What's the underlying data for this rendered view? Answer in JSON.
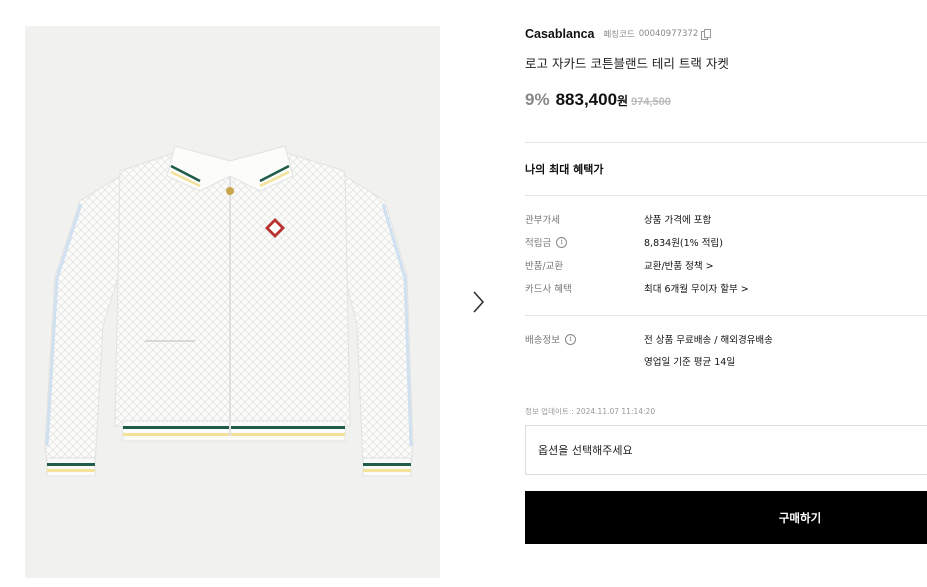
{
  "product_image": {
    "alt": "Casablanca"
  },
  "brand": "Casablanca",
  "product_code": {
    "label": "페칭코드",
    "value": "00040977372",
    "copy_icon": "copy-icon"
  },
  "product_name": "로고 자카드 코튼블랜드 테리 트랙 자켓",
  "price": {
    "discount": "9%",
    "current": "883,400",
    "currency": "원",
    "original": "974,500"
  },
  "benefit_title": "나의 최대 혜택가",
  "details": [
    {
      "label": "관부가세",
      "value": "상품 가격에 포함"
    },
    {
      "label": "적립금",
      "value": "8,834원(1% 적립)"
    },
    {
      "label": "반품/교환",
      "value": "교환/반품 정책 >"
    },
    {
      "label": "카드사 혜택",
      "value": "최대 6개월 무이자 할부 >"
    }
  ],
  "shipping": {
    "label": "배송정보",
    "line1": "전 상품 무료배송 / 해외경유배송",
    "line2": "영업일 기준 평균 14일"
  },
  "info_icon_glyph": "i",
  "update_info": "정보 업데이트 : 2024.11.07 11:14:20",
  "option_placeholder": "옵션을 선택해주세요",
  "buy_label": "구매하기"
}
